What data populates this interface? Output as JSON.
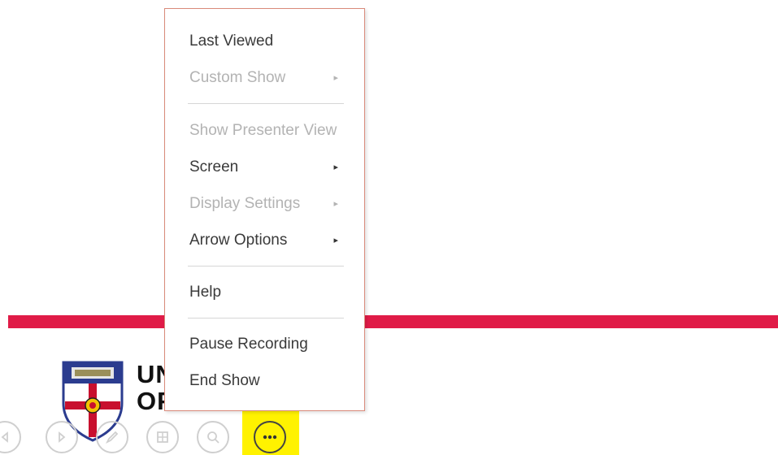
{
  "menu": {
    "items": [
      {
        "label": "Last Viewed",
        "disabled": false,
        "submenu": false
      },
      {
        "label": "Custom Show",
        "disabled": true,
        "submenu": true
      },
      {
        "label": "Show Presenter View",
        "disabled": true,
        "submenu": false
      },
      {
        "label": "Screen",
        "disabled": false,
        "submenu": true
      },
      {
        "label": "Display Settings",
        "disabled": true,
        "submenu": true
      },
      {
        "label": "Arrow Options",
        "disabled": false,
        "submenu": true
      },
      {
        "label": "Help",
        "disabled": false,
        "submenu": false
      },
      {
        "label": "Pause Recording",
        "disabled": false,
        "submenu": false
      },
      {
        "label": "End Show",
        "disabled": false,
        "submenu": false
      }
    ],
    "submenu_arrow": "▸"
  },
  "logo": {
    "line1": "UNIVERSITY",
    "line2": "OF LONDON"
  },
  "toolbar": {
    "buttons": [
      "previous-icon",
      "next-icon",
      "pen-icon",
      "slides-icon",
      "zoom-icon",
      "more-icon"
    ],
    "more_label": "•••"
  },
  "colors": {
    "accent_red": "#e01b47",
    "highlight": "#fff200",
    "menu_border": "#d98a7a",
    "disabled_text": "#b3b3b3"
  }
}
